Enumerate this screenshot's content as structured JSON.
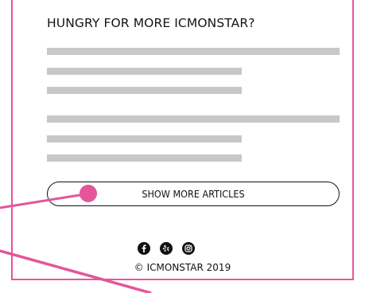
{
  "card": {
    "heading": "HUNGRY FOR MORE ICMONSTAR?",
    "show_more_label": "SHOW MORE ARTICLES",
    "social_icons": [
      "facebook-icon",
      "yelp-icon",
      "instagram-icon"
    ],
    "copyright": "© ICMONSTAR 2019"
  },
  "colors": {
    "accent": "#e4559a",
    "placeholder": "#c8c8c8",
    "text": "#111111"
  }
}
